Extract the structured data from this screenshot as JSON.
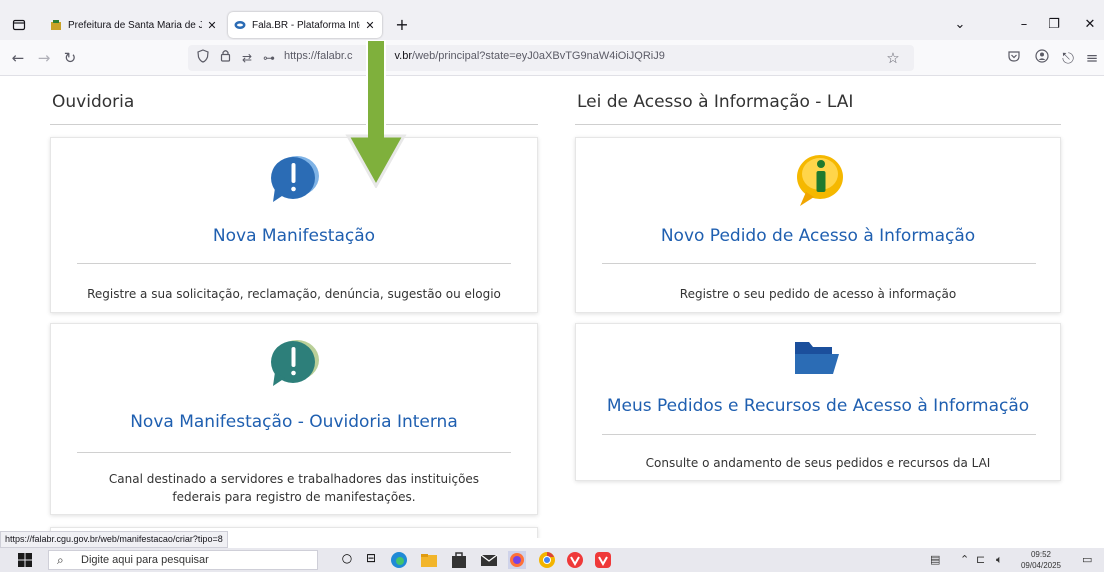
{
  "browser": {
    "tabs": [
      {
        "title": "Prefeitura de Santa Maria de Jet",
        "active": false
      },
      {
        "title": "Fala.BR - Plataforma Integrada d",
        "active": true
      }
    ],
    "url_prefix": "https://falabr.c",
    "url_middle": "v.br",
    "url_suffix": "/web/principal?state=eyJ0aXBvTG9naW4iOiJQRiJ9",
    "status_url": "https://falabr.cgu.gov.br/web/manifestacao/criar?tipo=8"
  },
  "ouvidoria": {
    "heading": "Ouvidoria",
    "cards": [
      {
        "title": "Nova Manifestação",
        "desc": "Registre a sua solicitação, reclamação, denúncia, sugestão ou elogio"
      },
      {
        "title": "Nova Manifestação - Ouvidoria Interna",
        "desc_line1": "Canal destinado a servidores e trabalhadores das instituições",
        "desc_line2": "federais para registro de manifestações."
      }
    ]
  },
  "lai": {
    "heading": "Lei de Acesso à Informação - LAI",
    "cards": [
      {
        "title": "Novo Pedido de Acesso à Informação",
        "desc": "Registre o seu pedido de acesso à informação"
      },
      {
        "title": "Meus Pedidos e Recursos de Acesso à Informação",
        "desc": "Consulte o andamento de seus pedidos e recursos da LAI"
      }
    ]
  },
  "taskbar": {
    "search_placeholder": "Digite aqui para pesquisar",
    "time": "09:52",
    "date": "09/04/2025"
  },
  "colors": {
    "link_blue": "#1f5fb0",
    "arrow_green": "#7fb03c",
    "icon_blue": "#2b6cb5",
    "icon_teal": "#2d7f7a",
    "icon_yellow": "#f5b800"
  }
}
